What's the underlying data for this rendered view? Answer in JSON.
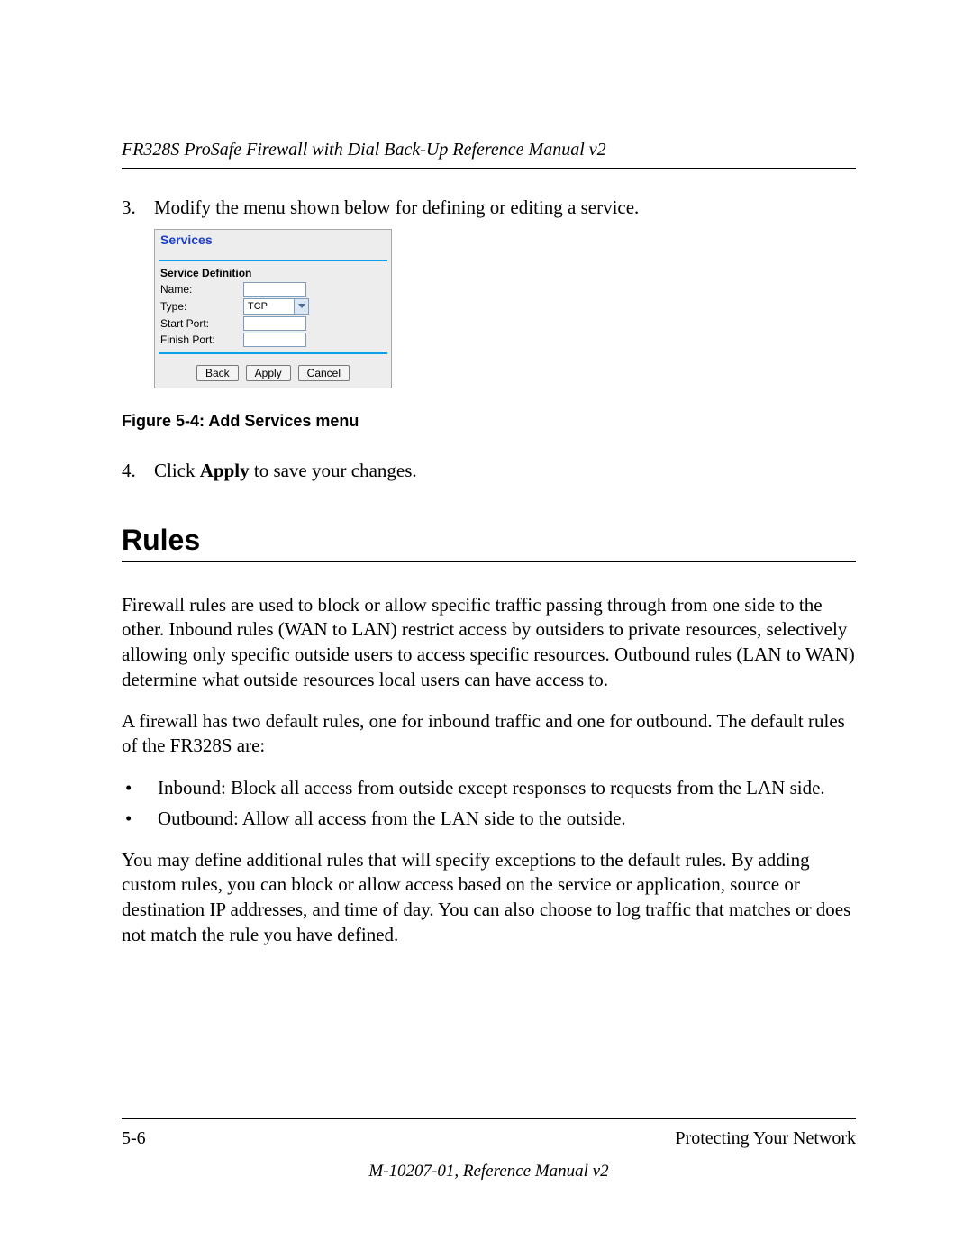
{
  "header": {
    "title": "FR328S ProSafe Firewall with Dial Back-Up Reference Manual v2"
  },
  "steps": {
    "s3": {
      "num": "3.",
      "text": "Modify the menu shown below for defining or editing a service."
    },
    "s4": {
      "num": "4.",
      "pre": "Click ",
      "bold": "Apply",
      "post": " to save your changes."
    }
  },
  "figure": {
    "caption": "Figure 5-4:  Add Services menu",
    "panel": {
      "title": "Services",
      "section": "Service Definition",
      "fields": {
        "name": "Name:",
        "type": "Type:",
        "type_value": "TCP",
        "start": "Start Port:",
        "finish": "Finish Port:"
      },
      "buttons": {
        "back": "Back",
        "apply": "Apply",
        "cancel": "Cancel"
      }
    }
  },
  "section": {
    "heading": "Rules",
    "p1": "Firewall rules are used to block or allow specific traffic passing through from one side to the other. Inbound rules (WAN to LAN) restrict access by outsiders to private resources, selectively allowing only specific outside users to access specific resources. Outbound rules (LAN to WAN) determine what outside resources local users can have access to.",
    "p2": "A firewall has two default rules, one for inbound traffic and one for outbound. The default rules of the FR328S are:",
    "bullets": [
      "Inbound: Block all access from outside except responses to requests from the LAN side.",
      "Outbound: Allow all access from the LAN side to the outside."
    ],
    "p3": "You may define additional rules that will specify exceptions to the default rules. By adding custom rules, you can block or allow access based on the service or application, source or destination IP addresses, and time of day. You can also choose to log traffic that matches or does not match the rule you have defined."
  },
  "footer": {
    "left": "5-6",
    "right": "Protecting Your Network",
    "center": "M-10207-01, Reference Manual v2"
  }
}
